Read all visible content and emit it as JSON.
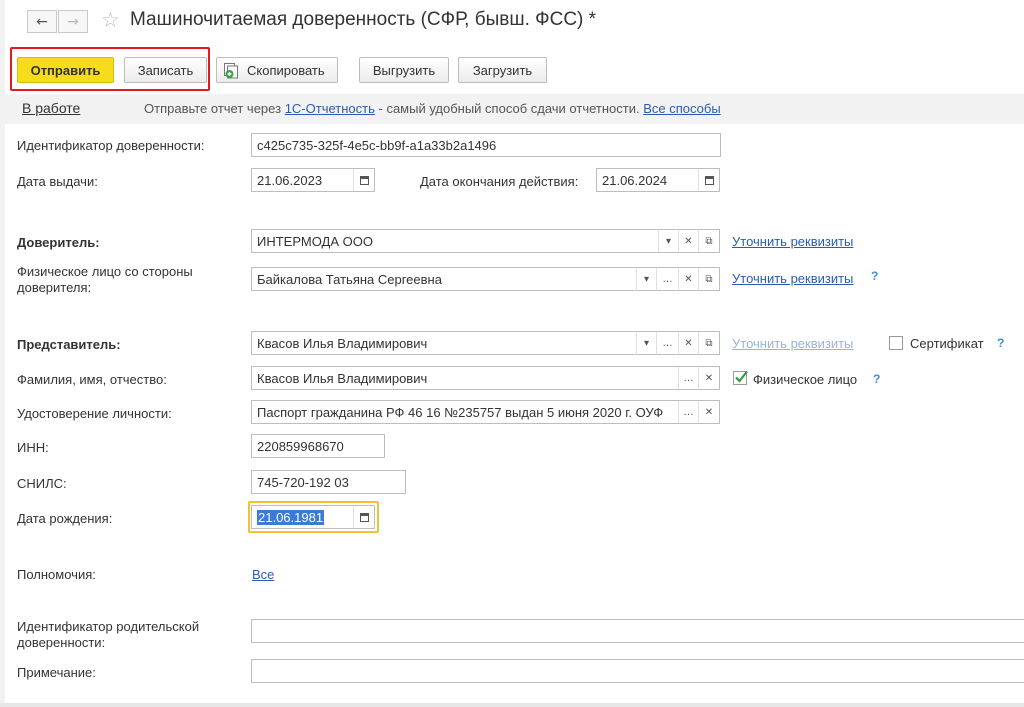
{
  "window": {
    "title": "Машиночитаемая доверенность (СФР, бывш. ФСС) *",
    "back_icon": "←",
    "forward_icon": "→",
    "favorite_icon": "☆"
  },
  "toolbar": {
    "send_label": "Отправить",
    "save_label": "Записать",
    "copy_label": "Скопировать",
    "export_label": "Выгрузить",
    "import_label": "Загрузить"
  },
  "infobar": {
    "status_link": "В работе",
    "text_prefix": "Отправьте отчет через",
    "service_link": "1С-Отчетность",
    "text_suffix": "- самый удобный способ сдачи отчетности.",
    "all_methods_link": "Все способы"
  },
  "form": {
    "identifier_label": "Идентификатор доверенности:",
    "identifier_value": "c425c735-325f-4e5c-bb9f-a1a33b2a1496",
    "issue_date_label": "Дата выдачи:",
    "issue_date_value": "21.06.2023",
    "end_date_label": "Дата окончания действия:",
    "end_date_value": "21.06.2024",
    "principal_label": "Доверитель:",
    "principal_value": "ИНТЕРМОДА ООО",
    "principal_details_link": "Уточнить реквизиты",
    "principal_person_label_line1": "Физическое лицо со стороны",
    "principal_person_label_line2": "доверителя:",
    "principal_person_value": "Байкалова Татьяна Сергеевна",
    "principal_person_details_link": "Уточнить реквизиты",
    "help_mark": "?",
    "representative_label": "Представитель:",
    "representative_value": "Квасов Илья Владимирович",
    "representative_details_link": "Уточнить реквизиты",
    "certificate_label": "Сертификат",
    "fullname_label": "Фамилия, имя, отчество:",
    "fullname_value": "Квасов Илья Владимирович",
    "individual_label": "Физическое лицо",
    "individual_checked": true,
    "id_document_label": "Удостоверение личности:",
    "id_document_value": "Паспорт гражданина РФ 46 16 №235757 выдан 5 июня 2020 г. ОУФ",
    "inn_label": "ИНН:",
    "inn_value": "220859968670",
    "snils_label": "СНИЛС:",
    "snils_value": "745-720-192 03",
    "birth_date_label": "Дата рождения:",
    "birth_date_value": "21.06.1981",
    "powers_label": "Полномочия:",
    "powers_link": "Все",
    "parent_id_label_line1": "Идентификатор родительской",
    "parent_id_label_line2": "доверенности:",
    "parent_id_value": "",
    "note_label": "Примечание:",
    "note_value": ""
  },
  "colors": {
    "primary_button": "#f7dc1c",
    "highlight_box": "#e8171d",
    "link": "#2a5db0",
    "focus_border": "#f2c230",
    "selection": "#3b7bd8",
    "checkmark": "#2f9e3b"
  }
}
